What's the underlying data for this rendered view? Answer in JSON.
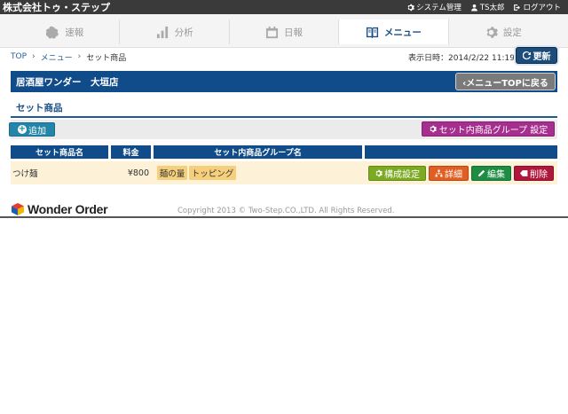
{
  "topbar": {
    "company": "株式会社トゥ・ステップ",
    "system_admin": "システム管理",
    "user": "TS太郎",
    "logout": "ログアウト"
  },
  "nav": {
    "tabs": [
      {
        "label": "速報",
        "icon": "bolt-icon",
        "active": false
      },
      {
        "label": "分析",
        "icon": "bar-chart-icon",
        "active": false
      },
      {
        "label": "日報",
        "icon": "calendar-icon",
        "active": false
      },
      {
        "label": "メニュー",
        "icon": "book-icon",
        "active": true
      },
      {
        "label": "設定",
        "icon": "gear-icon",
        "active": false
      }
    ]
  },
  "breadcrumb": {
    "items": [
      "TOP",
      "メニュー",
      "セット商品"
    ]
  },
  "datetime": "表示日時：2014/2/22 11:19",
  "refresh_label": "更新",
  "store": {
    "name": "居酒屋ワンダー　大垣店",
    "back_label": "‹メニューTOPに戻る"
  },
  "section": {
    "title": "セット商品",
    "add_label": "追加",
    "group_setting_label": "セット内商品グループ 設定"
  },
  "table": {
    "headers": [
      "セット商品名",
      "料金",
      "セット内商品グループ名",
      ""
    ],
    "rows": [
      {
        "name": "つけ麺",
        "price": "¥800",
        "groups": [
          "麺の量",
          "トッピング"
        ],
        "actions": {
          "config": "構成設定",
          "detail": "詳細",
          "edit": "編集",
          "delete": "削除"
        }
      }
    ]
  },
  "footer": {
    "logo_text": "Wonder Order",
    "copyright": "Copyright 2013 © Two-Step.CO.,LTD. All Rights Reserved."
  },
  "colors": {
    "primary": "#104b8a",
    "row_bg": "#fdf1d8",
    "group_tag": "#f5cf7c",
    "add": "#2386a8",
    "group_setting": "#a62e8f",
    "config": "#7cab23",
    "detail": "#e05f24",
    "edit": "#1f8c43",
    "delete": "#b0173c"
  }
}
